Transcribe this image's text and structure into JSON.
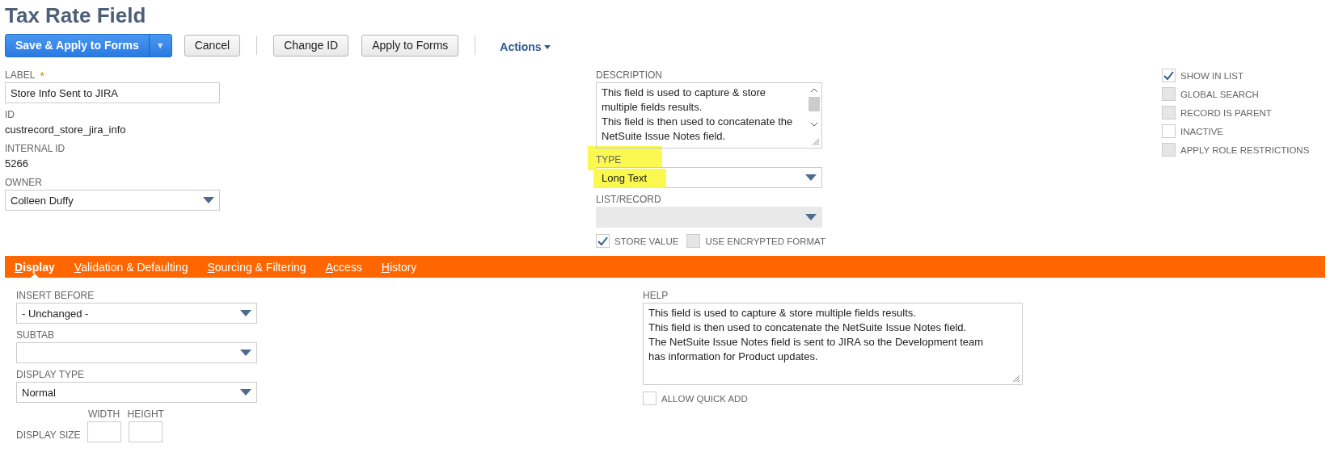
{
  "title": "Tax Rate Field",
  "toolbar": [
    {
      "kind": "primary",
      "label": "Save & Apply to Forms",
      "caret": "▼"
    },
    {
      "kind": "button",
      "label": "Cancel"
    },
    {
      "kind": "separator"
    },
    {
      "kind": "button",
      "label": "Change ID"
    },
    {
      "kind": "button",
      "label": "Apply to Forms"
    },
    {
      "kind": "separator"
    },
    {
      "kind": "menu",
      "label": "Actions"
    }
  ],
  "main_fields": [
    {
      "kind": "input",
      "label": "LABEL",
      "required_mark": "*",
      "value": "Store Info Sent to JIRA"
    },
    {
      "kind": "text",
      "label": "ID",
      "value": "custrecord_store_jira_info"
    },
    {
      "kind": "text",
      "label": "INTERNAL ID",
      "value": "5266"
    },
    {
      "kind": "select",
      "label": "OWNER",
      "value": "Colleen Duffy"
    }
  ],
  "type_fields": [
    {
      "kind": "textarea",
      "label": "DESCRIPTION",
      "scrollbar": true,
      "value": "This field is used to capture & store multiple fields results.\nThis field is then used to concatenate the NetSuite Issue Notes field."
    },
    {
      "kind": "select",
      "label": "TYPE",
      "value": "Long Text",
      "highlighted": true
    },
    {
      "kind": "select",
      "label": "LIST/RECORD",
      "disabled": true
    },
    {
      "kind": "checks",
      "options": [
        {
          "label": "STORE VALUE",
          "checked": true,
          "disabled": false
        },
        {
          "label": "USE ENCRYPTED FORMAT",
          "checked": false,
          "disabled": true
        }
      ]
    }
  ],
  "flags": [
    {
      "label": "SHOW IN LIST",
      "checked": true,
      "disabled": false
    },
    {
      "label": "GLOBAL SEARCH",
      "checked": false,
      "disabled": true
    },
    {
      "label": "RECORD IS PARENT",
      "checked": false,
      "disabled": true
    },
    {
      "label": "INACTIVE",
      "checked": false,
      "disabled": false
    },
    {
      "label": "APPLY ROLE RESTRICTIONS",
      "checked": false,
      "disabled": true
    }
  ],
  "tabs": [
    {
      "label": "Display",
      "selected": true
    },
    {
      "label": "Validation & Defaulting",
      "selected": false
    },
    {
      "label": "Sourcing & Filtering",
      "selected": false
    },
    {
      "label": "Access",
      "selected": false
    },
    {
      "label": "History",
      "selected": false
    }
  ],
  "display_fields": [
    {
      "kind": "select",
      "label": "INSERT BEFORE",
      "value": "- Unchanged -"
    },
    {
      "kind": "select",
      "label": "SUBTAB"
    },
    {
      "kind": "select",
      "label": "DISPLAY TYPE",
      "value": "Normal"
    },
    {
      "kind": "size",
      "label": "DISPLAY SIZE",
      "inputs": [
        {
          "label": "WIDTH"
        },
        {
          "label": "HEIGHT"
        }
      ]
    }
  ],
  "help_fields": [
    {
      "kind": "textarea",
      "label": "HELP",
      "value": "This field is used to capture & store multiple fields results.\nThis field is then used to concatenate the NetSuite Issue Notes field.\nThe NetSuite Issue Notes field is sent to JIRA so the Development team has information for Product updates.",
      "scrollbar": false
    },
    {
      "kind": "checks",
      "options": [
        {
          "label": "ALLOW QUICK ADD",
          "checked": false,
          "disabled": false
        }
      ]
    }
  ]
}
